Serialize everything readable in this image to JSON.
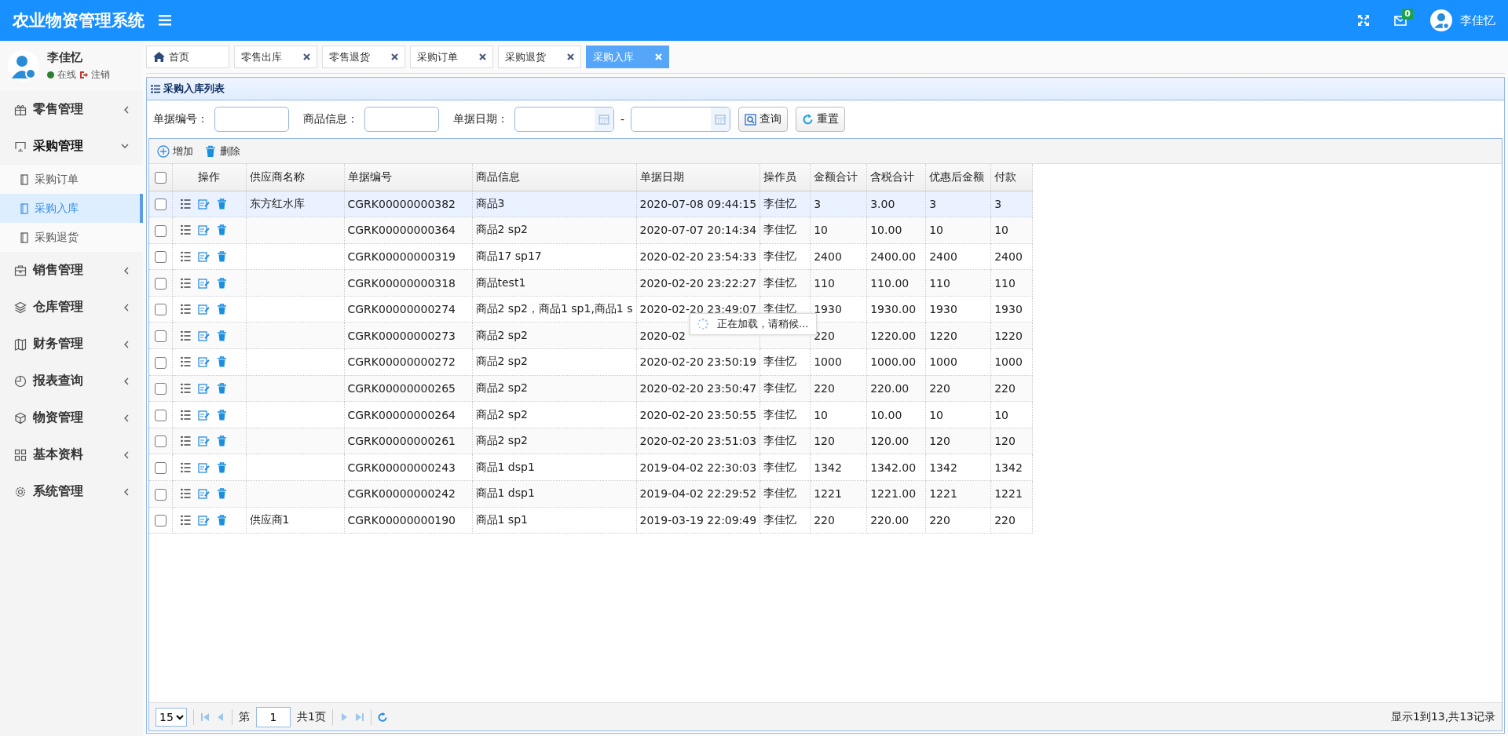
{
  "app": {
    "title": "农业物资管理系统",
    "mail_count": "0",
    "user_name": "李佳忆"
  },
  "sidebar": {
    "user": {
      "name": "李佳忆",
      "status": "在线",
      "logout": "注销"
    },
    "items": [
      {
        "label": "零售管理",
        "expanded": false
      },
      {
        "label": "采购管理",
        "expanded": true,
        "children": [
          {
            "label": "采购订单",
            "selected": false
          },
          {
            "label": "采购入库",
            "selected": true
          },
          {
            "label": "采购退货",
            "selected": false
          }
        ]
      },
      {
        "label": "销售管理",
        "expanded": false
      },
      {
        "label": "仓库管理",
        "expanded": false
      },
      {
        "label": "财务管理",
        "expanded": false
      },
      {
        "label": "报表查询",
        "expanded": false
      },
      {
        "label": "物资管理",
        "expanded": false
      },
      {
        "label": "基本资料",
        "expanded": false
      },
      {
        "label": "系统管理",
        "expanded": false
      }
    ]
  },
  "tabs": [
    {
      "label": "首页",
      "closable": false,
      "selected": false
    },
    {
      "label": "零售出库",
      "closable": true,
      "selected": false
    },
    {
      "label": "零售退货",
      "closable": true,
      "selected": false
    },
    {
      "label": "采购订单",
      "closable": true,
      "selected": false
    },
    {
      "label": "采购退货",
      "closable": true,
      "selected": false
    },
    {
      "label": "采购入库",
      "closable": true,
      "selected": true
    }
  ],
  "panel": {
    "title": "采购入库列表"
  },
  "search": {
    "fields": [
      {
        "label": "单据编号："
      },
      {
        "label": "商品信息："
      }
    ],
    "date": {
      "label": "单据日期：",
      "separator": "-"
    },
    "buttons": [
      "查询",
      "重置"
    ]
  },
  "toolbar": [
    "增加",
    "删除"
  ],
  "table": {
    "header_checked": false,
    "columns": [
      "操作",
      "供应商名称",
      "单据编号",
      "商品信息",
      "单据日期",
      "操作员",
      "金额合计",
      "含税合计",
      "优惠后金额",
      "付款"
    ],
    "rows": [
      {
        "selected": true,
        "checked": false,
        "cells": [
          "",
          "东方红水库",
          "CGRK00000000382",
          "商品3",
          "2020-07-08 09:44:15",
          "李佳忆",
          "3",
          "3.00",
          "3",
          "3"
        ]
      },
      {
        "selected": false,
        "checked": false,
        "cells": [
          "",
          "",
          "CGRK00000000364",
          "商品2 sp2",
          "2020-07-07 20:14:34",
          "李佳忆",
          "10",
          "10.00",
          "10",
          "10"
        ]
      },
      {
        "selected": false,
        "checked": false,
        "cells": [
          "",
          "",
          "CGRK00000000319",
          "商品17 sp17",
          "2020-02-20 23:54:33",
          "李佳忆",
          "2400",
          "2400.00",
          "2400",
          "2400"
        ]
      },
      {
        "selected": false,
        "checked": false,
        "cells": [
          "",
          "",
          "CGRK00000000318",
          "商品test1",
          "2020-02-20 23:22:27",
          "李佳忆",
          "110",
          "110.00",
          "110",
          "110"
        ]
      },
      {
        "selected": false,
        "checked": false,
        "cells": [
          "",
          "",
          "CGRK00000000274",
          "商品2 sp2，商品1 sp1,商品1 s",
          "2020-02-20 23:49:07",
          "李佳忆",
          "1930",
          "1930.00",
          "1930",
          "1930"
        ]
      },
      {
        "selected": false,
        "checked": false,
        "cells": [
          "",
          "",
          "CGRK00000000273",
          "商品2 sp2",
          "2020-02",
          "",
          "220",
          "1220.00",
          "1220",
          "1220"
        ]
      },
      {
        "selected": false,
        "checked": false,
        "cells": [
          "",
          "",
          "CGRK00000000272",
          "商品2 sp2",
          "2020-02-20 23:50:19",
          "李佳忆",
          "1000",
          "1000.00",
          "1000",
          "1000"
        ]
      },
      {
        "selected": false,
        "checked": false,
        "cells": [
          "",
          "",
          "CGRK00000000265",
          "商品2 sp2",
          "2020-02-20 23:50:47",
          "李佳忆",
          "220",
          "220.00",
          "220",
          "220"
        ]
      },
      {
        "selected": false,
        "checked": false,
        "cells": [
          "",
          "",
          "CGRK00000000264",
          "商品2 sp2",
          "2020-02-20 23:50:55",
          "李佳忆",
          "10",
          "10.00",
          "10",
          "10"
        ]
      },
      {
        "selected": false,
        "checked": false,
        "cells": [
          "",
          "",
          "CGRK00000000261",
          "商品2 sp2",
          "2020-02-20 23:51:03",
          "李佳忆",
          "120",
          "120.00",
          "120",
          "120"
        ]
      },
      {
        "selected": false,
        "checked": false,
        "cells": [
          "",
          "",
          "CGRK00000000243",
          "商品1 dsp1",
          "2019-04-02 22:30:03",
          "李佳忆",
          "1342",
          "1342.00",
          "1342",
          "1342"
        ]
      },
      {
        "selected": false,
        "checked": false,
        "cells": [
          "",
          "",
          "CGRK00000000242",
          "商品1 dsp1",
          "2019-04-02 22:29:52",
          "李佳忆",
          "1221",
          "1221.00",
          "1221",
          "1221"
        ]
      },
      {
        "selected": false,
        "checked": false,
        "cells": [
          "",
          "供应商1",
          "CGRK00000000190",
          "商品1 sp1",
          "2019-03-19 22:09:49",
          "李佳忆",
          "220",
          "220.00",
          "220",
          "220"
        ]
      }
    ]
  },
  "loading": {
    "text": "正在加载，请稍候..."
  },
  "pager": {
    "page_size": "15",
    "page_label": "第",
    "page": "1",
    "total_pages": "共1页",
    "summary": "显示1到13,共13记录"
  }
}
